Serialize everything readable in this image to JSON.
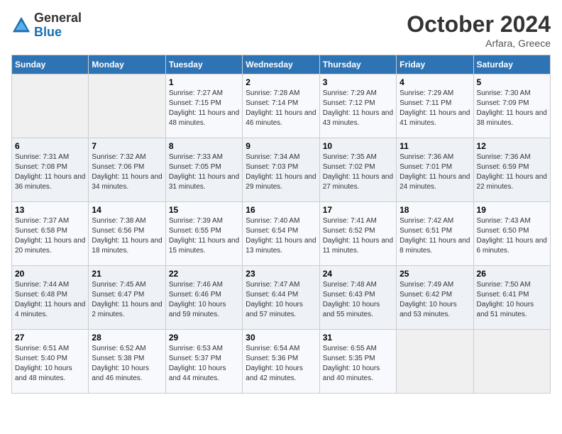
{
  "logo": {
    "general": "General",
    "blue": "Blue"
  },
  "title": "October 2024",
  "subtitle": "Arfara, Greece",
  "days_of_week": [
    "Sunday",
    "Monday",
    "Tuesday",
    "Wednesday",
    "Thursday",
    "Friday",
    "Saturday"
  ],
  "weeks": [
    [
      {
        "day": "",
        "info": ""
      },
      {
        "day": "",
        "info": ""
      },
      {
        "day": "1",
        "info": "Sunrise: 7:27 AM\nSunset: 7:15 PM\nDaylight: 11 hours and 48 minutes."
      },
      {
        "day": "2",
        "info": "Sunrise: 7:28 AM\nSunset: 7:14 PM\nDaylight: 11 hours and 46 minutes."
      },
      {
        "day": "3",
        "info": "Sunrise: 7:29 AM\nSunset: 7:12 PM\nDaylight: 11 hours and 43 minutes."
      },
      {
        "day": "4",
        "info": "Sunrise: 7:29 AM\nSunset: 7:11 PM\nDaylight: 11 hours and 41 minutes."
      },
      {
        "day": "5",
        "info": "Sunrise: 7:30 AM\nSunset: 7:09 PM\nDaylight: 11 hours and 38 minutes."
      }
    ],
    [
      {
        "day": "6",
        "info": "Sunrise: 7:31 AM\nSunset: 7:08 PM\nDaylight: 11 hours and 36 minutes."
      },
      {
        "day": "7",
        "info": "Sunrise: 7:32 AM\nSunset: 7:06 PM\nDaylight: 11 hours and 34 minutes."
      },
      {
        "day": "8",
        "info": "Sunrise: 7:33 AM\nSunset: 7:05 PM\nDaylight: 11 hours and 31 minutes."
      },
      {
        "day": "9",
        "info": "Sunrise: 7:34 AM\nSunset: 7:03 PM\nDaylight: 11 hours and 29 minutes."
      },
      {
        "day": "10",
        "info": "Sunrise: 7:35 AM\nSunset: 7:02 PM\nDaylight: 11 hours and 27 minutes."
      },
      {
        "day": "11",
        "info": "Sunrise: 7:36 AM\nSunset: 7:01 PM\nDaylight: 11 hours and 24 minutes."
      },
      {
        "day": "12",
        "info": "Sunrise: 7:36 AM\nSunset: 6:59 PM\nDaylight: 11 hours and 22 minutes."
      }
    ],
    [
      {
        "day": "13",
        "info": "Sunrise: 7:37 AM\nSunset: 6:58 PM\nDaylight: 11 hours and 20 minutes."
      },
      {
        "day": "14",
        "info": "Sunrise: 7:38 AM\nSunset: 6:56 PM\nDaylight: 11 hours and 18 minutes."
      },
      {
        "day": "15",
        "info": "Sunrise: 7:39 AM\nSunset: 6:55 PM\nDaylight: 11 hours and 15 minutes."
      },
      {
        "day": "16",
        "info": "Sunrise: 7:40 AM\nSunset: 6:54 PM\nDaylight: 11 hours and 13 minutes."
      },
      {
        "day": "17",
        "info": "Sunrise: 7:41 AM\nSunset: 6:52 PM\nDaylight: 11 hours and 11 minutes."
      },
      {
        "day": "18",
        "info": "Sunrise: 7:42 AM\nSunset: 6:51 PM\nDaylight: 11 hours and 8 minutes."
      },
      {
        "day": "19",
        "info": "Sunrise: 7:43 AM\nSunset: 6:50 PM\nDaylight: 11 hours and 6 minutes."
      }
    ],
    [
      {
        "day": "20",
        "info": "Sunrise: 7:44 AM\nSunset: 6:48 PM\nDaylight: 11 hours and 4 minutes."
      },
      {
        "day": "21",
        "info": "Sunrise: 7:45 AM\nSunset: 6:47 PM\nDaylight: 11 hours and 2 minutes."
      },
      {
        "day": "22",
        "info": "Sunrise: 7:46 AM\nSunset: 6:46 PM\nDaylight: 10 hours and 59 minutes."
      },
      {
        "day": "23",
        "info": "Sunrise: 7:47 AM\nSunset: 6:44 PM\nDaylight: 10 hours and 57 minutes."
      },
      {
        "day": "24",
        "info": "Sunrise: 7:48 AM\nSunset: 6:43 PM\nDaylight: 10 hours and 55 minutes."
      },
      {
        "day": "25",
        "info": "Sunrise: 7:49 AM\nSunset: 6:42 PM\nDaylight: 10 hours and 53 minutes."
      },
      {
        "day": "26",
        "info": "Sunrise: 7:50 AM\nSunset: 6:41 PM\nDaylight: 10 hours and 51 minutes."
      }
    ],
    [
      {
        "day": "27",
        "info": "Sunrise: 6:51 AM\nSunset: 5:40 PM\nDaylight: 10 hours and 48 minutes."
      },
      {
        "day": "28",
        "info": "Sunrise: 6:52 AM\nSunset: 5:38 PM\nDaylight: 10 hours and 46 minutes."
      },
      {
        "day": "29",
        "info": "Sunrise: 6:53 AM\nSunset: 5:37 PM\nDaylight: 10 hours and 44 minutes."
      },
      {
        "day": "30",
        "info": "Sunrise: 6:54 AM\nSunset: 5:36 PM\nDaylight: 10 hours and 42 minutes."
      },
      {
        "day": "31",
        "info": "Sunrise: 6:55 AM\nSunset: 5:35 PM\nDaylight: 10 hours and 40 minutes."
      },
      {
        "day": "",
        "info": ""
      },
      {
        "day": "",
        "info": ""
      }
    ]
  ]
}
